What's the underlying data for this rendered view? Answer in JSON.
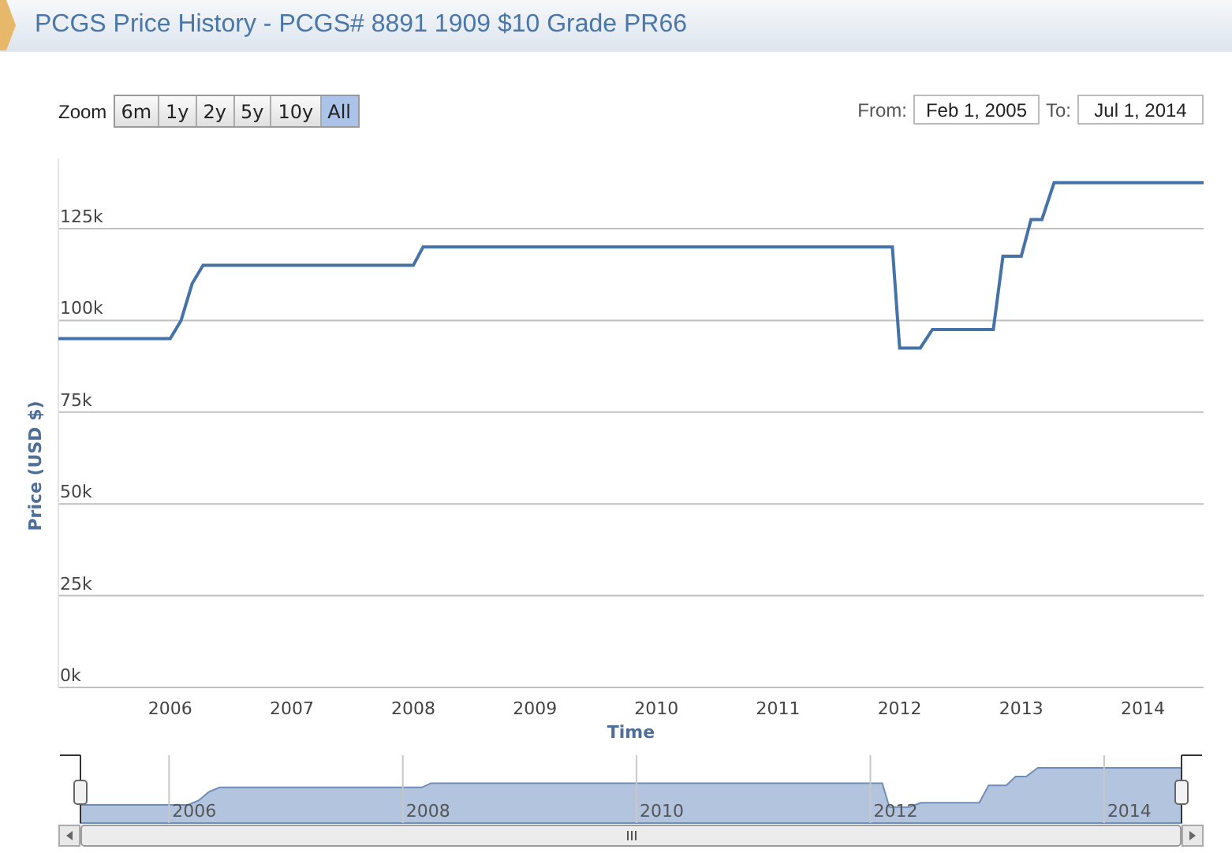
{
  "header": {
    "title": "PCGS Price History - PCGS# 8891 1909 $10 Grade PR66"
  },
  "zoom": {
    "label": "Zoom",
    "buttons": [
      {
        "label": "6m",
        "selected": false
      },
      {
        "label": "1y",
        "selected": false
      },
      {
        "label": "2y",
        "selected": false
      },
      {
        "label": "5y",
        "selected": false
      },
      {
        "label": "10y",
        "selected": false
      },
      {
        "label": "All",
        "selected": true
      }
    ]
  },
  "range": {
    "from_label": "From:",
    "from": "Feb 1, 2005",
    "to_label": "To:",
    "to": "Jul 1, 2014"
  },
  "chart_data": {
    "type": "line",
    "xlabel": "Time",
    "ylabel": "Price (USD $)",
    "xlim": [
      2005.08,
      2014.5
    ],
    "ylim": [
      0,
      144
    ],
    "grid": true,
    "xticks": [
      {
        "value": 2006,
        "label": "2006"
      },
      {
        "value": 2007,
        "label": "2007"
      },
      {
        "value": 2008,
        "label": "2008"
      },
      {
        "value": 2009,
        "label": "2009"
      },
      {
        "value": 2010,
        "label": "2010"
      },
      {
        "value": 2011,
        "label": "2011"
      },
      {
        "value": 2012,
        "label": "2012"
      },
      {
        "value": 2013,
        "label": "2013"
      },
      {
        "value": 2014,
        "label": "2014"
      }
    ],
    "yticks": [
      {
        "value": 0,
        "label": "0k"
      },
      {
        "value": 25,
        "label": "25k"
      },
      {
        "value": 50,
        "label": "50k"
      },
      {
        "value": 75,
        "label": "75k"
      },
      {
        "value": 100,
        "label": "100k"
      },
      {
        "value": 125,
        "label": "125k"
      }
    ],
    "x": [
      2005.08,
      2006.0,
      2006.09,
      2006.18,
      2006.27,
      2008.0,
      2008.08,
      2011.94,
      2012.0,
      2012.17,
      2012.27,
      2012.77,
      2012.85,
      2013.0,
      2013.08,
      2013.17,
      2013.27,
      2014.5
    ],
    "series": [
      {
        "color": "#4572a7",
        "values": [
          95,
          95,
          100,
          110,
          115,
          115,
          120,
          120,
          92.5,
          92.5,
          97.5,
          97.5,
          117.5,
          117.5,
          127.5,
          127.5,
          137.5,
          137.5
        ]
      }
    ]
  },
  "navigator": {
    "labels": [
      "2006",
      "2008",
      "2010",
      "2012",
      "2014"
    ]
  }
}
